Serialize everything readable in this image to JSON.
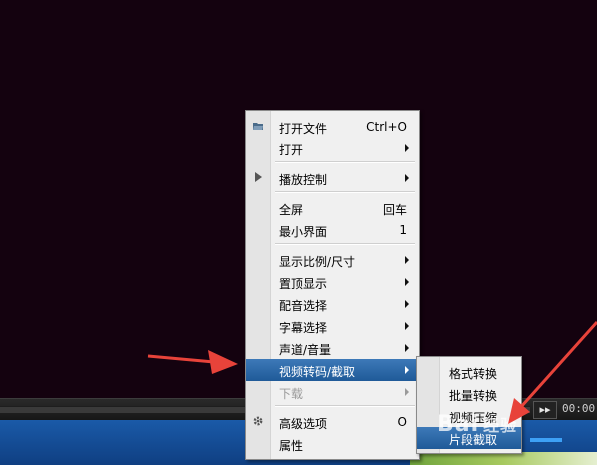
{
  "menu": {
    "items": [
      {
        "label": "打开文件",
        "shortcut": "Ctrl+O",
        "icon": "open-folder-icon"
      },
      {
        "label": "打开",
        "submenu": true
      },
      {
        "label": "播放控制",
        "submenu": true,
        "icon": "play-icon"
      },
      {
        "label": "全屏",
        "shortcut": "回车"
      },
      {
        "label": "最小界面",
        "shortcut": "1"
      },
      {
        "label": "显示比例/尺寸",
        "submenu": true
      },
      {
        "label": "置顶显示",
        "submenu": true
      },
      {
        "label": "配音选择",
        "submenu": true
      },
      {
        "label": "字幕选择",
        "submenu": true
      },
      {
        "label": "声道/音量",
        "submenu": true
      },
      {
        "label": "视频转码/截取",
        "submenu": true,
        "highlighted": true
      },
      {
        "label": "下载",
        "submenu": true,
        "disabled": true
      },
      {
        "label": "高级选项",
        "shortcut": "O",
        "icon": "gear-icon"
      },
      {
        "label": "属性"
      }
    ]
  },
  "submenu": {
    "items": [
      {
        "label": "格式转换"
      },
      {
        "label": "批量转换"
      },
      {
        "label": "视频压缩"
      },
      {
        "label": "片段截取",
        "highlighted": true
      }
    ]
  },
  "player": {
    "time": "00:00",
    "next_icon": "▸▸"
  },
  "watermark": {
    "brand": "Bai",
    "suffix": "经验"
  },
  "colors": {
    "highlight": "#2a64a4",
    "arrow": "#e8433a",
    "taskbar": "#1a5aa8"
  }
}
